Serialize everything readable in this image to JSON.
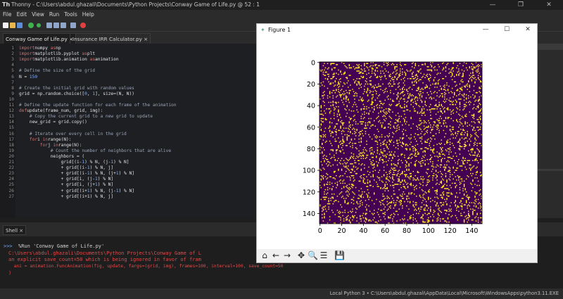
{
  "window": {
    "app_name": "Thonny",
    "path": "C:\\Users\\abdul.ghazali\\Documents\\Python Projects\\Conway Game of Life.py",
    "position": "@ 52 : 1",
    "minimize": "—",
    "maximize": "❐",
    "close": "✕"
  },
  "menu": [
    "File",
    "Edit",
    "View",
    "Run",
    "Tools",
    "Help"
  ],
  "tabs": [
    {
      "label": "Conway Game of Life.py ×",
      "active": true
    },
    {
      "label": "Insurance IRR Calculator.py ×",
      "active": false
    }
  ],
  "editor": {
    "line_numbers": [
      "1",
      "2",
      "3",
      "4",
      "5",
      "6",
      "7",
      "8",
      "9",
      "10",
      "11",
      "12",
      "13",
      "14",
      "15",
      "16",
      "17",
      "18",
      "19",
      "20",
      "21",
      "22",
      "23",
      "24",
      "25",
      "26",
      "27"
    ],
    "lines": [
      [
        [
          "kw",
          "import"
        ],
        [
          "",
          "numpy "
        ],
        [
          "kw",
          "as"
        ],
        [
          "",
          "np"
        ]
      ],
      [
        [
          "kw",
          "import"
        ],
        [
          "",
          "matplotlib.pyplot "
        ],
        [
          "kw",
          "as"
        ],
        [
          "",
          "plt"
        ]
      ],
      [
        [
          "kw",
          "import"
        ],
        [
          "",
          "matplotlib.animation "
        ],
        [
          "kw",
          "as"
        ],
        [
          "",
          "animation"
        ]
      ],
      [
        [
          "",
          ""
        ]
      ],
      [
        [
          "cm",
          "# Define the size of the grid"
        ]
      ],
      [
        [
          "",
          "N = "
        ],
        [
          "nm",
          "150"
        ]
      ],
      [
        [
          "",
          ""
        ]
      ],
      [
        [
          "cm",
          "# Create the initial grid with random values"
        ]
      ],
      [
        [
          "",
          "grid = np.random.choice(["
        ],
        [
          "nm",
          "0"
        ],
        [
          "",
          ", "
        ],
        [
          "nm",
          "1"
        ],
        [
          "",
          "], size=(N, N))"
        ]
      ],
      [
        [
          "",
          ""
        ]
      ],
      [
        [
          "cm",
          "# Define the update function for each frame of the animation"
        ]
      ],
      [
        [
          "kw",
          "def"
        ],
        [
          "",
          ""
        ],
        [
          "",
          "update(frame_num, grid, img):"
        ]
      ],
      [
        [
          "cm",
          "    # Copy the current grid to a new grid to update"
        ]
      ],
      [
        [
          "",
          "    new_grid = grid.copy()"
        ]
      ],
      [
        [
          "",
          ""
        ]
      ],
      [
        [
          "cm",
          "    # Iterate over every cell in the grid"
        ]
      ],
      [
        [
          "kw",
          "    for"
        ],
        [
          "",
          ""
        ],
        [
          "",
          "i "
        ],
        [
          "kw",
          "in"
        ],
        [
          "",
          ""
        ],
        [
          "",
          "range(N):"
        ]
      ],
      [
        [
          "kw",
          "        for"
        ],
        [
          "",
          ""
        ],
        [
          "",
          "j "
        ],
        [
          "kw",
          "in"
        ],
        [
          "",
          ""
        ],
        [
          "",
          "range(N):"
        ]
      ],
      [
        [
          "cm",
          "            # Count the number of neighbors that are alive"
        ]
      ],
      [
        [
          "",
          "            neighbors = ("
        ]
      ],
      [
        [
          "",
          "                grid[(i-"
        ],
        [
          "nm",
          "1"
        ],
        [
          "",
          ") % N, (j-"
        ],
        [
          "nm",
          "1"
        ],
        [
          "",
          ") % N]"
        ]
      ],
      [
        [
          "",
          "                + grid[(i-"
        ],
        [
          "nm",
          "1"
        ],
        [
          "",
          ") % N, j]"
        ]
      ],
      [
        [
          "",
          "                + grid[(i-"
        ],
        [
          "nm",
          "1"
        ],
        [
          "",
          ") % N, (j+"
        ],
        [
          "nm",
          "1"
        ],
        [
          "",
          ") % N]"
        ]
      ],
      [
        [
          "",
          "                + grid[i, (j-"
        ],
        [
          "nm",
          "1"
        ],
        [
          "",
          ") % N]"
        ]
      ],
      [
        [
          "",
          "                + grid[i, (j+"
        ],
        [
          "nm",
          "1"
        ],
        [
          "",
          ") % N]"
        ]
      ],
      [
        [
          "",
          "                + grid[(i+"
        ],
        [
          "nm",
          "1"
        ],
        [
          "",
          ") % N, (j-"
        ],
        [
          "nm",
          "1"
        ],
        [
          "",
          ") % N]"
        ]
      ],
      [
        [
          "",
          "                + grid[(i+1) % N, j]"
        ]
      ]
    ]
  },
  "shell": {
    "tab_label": "Shell ×",
    "prompt": ">>>",
    "command": "%Run 'Conway Game of Life.py'",
    "errors": [
      "C:\\Users\\abdul.ghazali\\Documents\\Python Projects\\Conway Game of L",
      "an explicit save_count=50 which is being ignored in favor of fram",
      "  ani = animation.FuncAnimation(fig, update, fargs=(grid, img), frames=100, interval=100, save_count=50",
      ")"
    ]
  },
  "status": {
    "interpreter": "Local Python 3  •  C:\\Users\\abdul.ghazali\\AppData\\Local\\Microsoft\\WindowsApps\\python3.11.EXE"
  },
  "figure": {
    "title": "Figure 1",
    "minimize": "—",
    "maximize": "☐",
    "close": "✕",
    "toolbar": [
      {
        "name": "home-icon",
        "glyph": "⌂"
      },
      {
        "name": "back-icon",
        "glyph": "←"
      },
      {
        "name": "forward-icon",
        "glyph": "→"
      },
      {
        "name": "pan-icon",
        "glyph": "✥"
      },
      {
        "name": "zoom-icon",
        "glyph": "🔍"
      },
      {
        "name": "configure-subplots-icon",
        "glyph": "☰"
      },
      {
        "name": "save-icon",
        "glyph": "💾"
      }
    ]
  },
  "chart_data": {
    "type": "heatmap",
    "title": "",
    "xlabel": "",
    "ylabel": "",
    "x_ticks": [
      "0",
      "20",
      "40",
      "60",
      "80",
      "100",
      "120",
      "140"
    ],
    "y_ticks": [
      "0",
      "20",
      "40",
      "60",
      "80",
      "100",
      "120",
      "140"
    ],
    "xlim": [
      0,
      150
    ],
    "ylim": [
      150,
      0
    ],
    "grid_size": [
      150,
      150
    ],
    "colormap": [
      "#440154",
      "#fde725"
    ],
    "values": "binary cell states (0 = dead, 1 = alive) of the Game of Life grid"
  },
  "colors": {
    "dead": "#440154",
    "alive": "#fde725",
    "error": "#e04b4b",
    "prompt": "#7fb0ff"
  }
}
